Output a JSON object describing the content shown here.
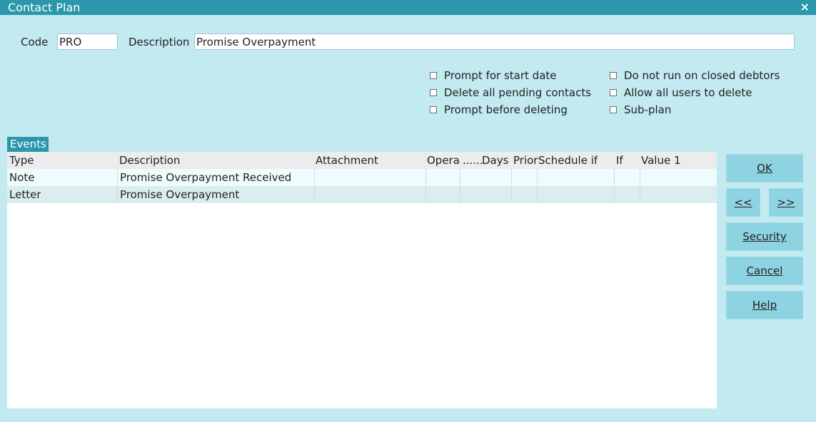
{
  "window": {
    "title": "Contact Plan",
    "close_label": "×"
  },
  "form": {
    "code_label": "Code",
    "code_value": "PRO",
    "description_label": "Description",
    "description_value": "Promise Overpayment"
  },
  "options": {
    "prompt_start_date": "Prompt for start date",
    "delete_pending": "Delete all pending contacts",
    "prompt_before_delete": "Prompt before deleting",
    "not_run_closed": "Do not run on closed debtors",
    "allow_all_delete": "Allow all users to delete",
    "sub_plan": "Sub-plan"
  },
  "events": {
    "tab_label": "Events",
    "columns": [
      "Type",
      "Description",
      "Attachment",
      "Opera",
      "......",
      "Days",
      "Priori",
      "Schedule if",
      "If",
      "Value 1"
    ],
    "rows": [
      {
        "type": "Note",
        "description": "Promise Overpayment Received"
      },
      {
        "type": "Letter",
        "description": "Promise Overpayment"
      }
    ]
  },
  "buttons": {
    "ok": "OK",
    "prev": "<<",
    "next": ">>",
    "security": "Security",
    "cancel": "Cancel",
    "help": "Help"
  }
}
